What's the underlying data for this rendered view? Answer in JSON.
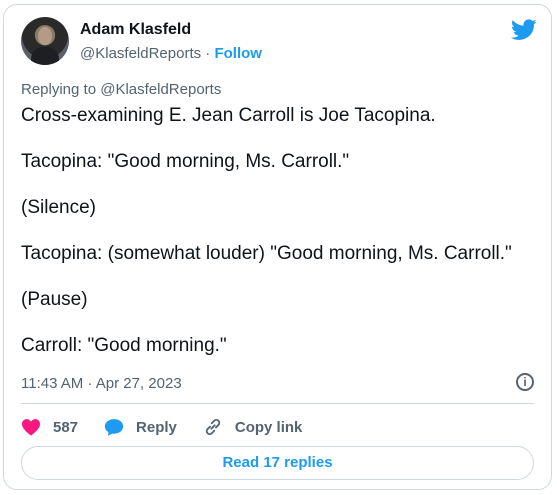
{
  "author": {
    "name": "Adam Klasfeld",
    "handle": "@KlasfeldReports",
    "separator": " · ",
    "follow_label": "Follow"
  },
  "replying_to": "Replying to @KlasfeldReports",
  "tweet_lines": [
    "Cross-examining E. Jean Carroll is Joe Tacopina.",
    "Tacopina: \"Good morning, Ms. Carroll.\"",
    "(Silence)",
    "Tacopina: (somewhat louder) \"Good morning, Ms. Carroll.\"",
    "(Pause)",
    "Carroll: \"Good morning.\""
  ],
  "timestamp": "11:43 AM · Apr 27, 2023",
  "actions": {
    "like_count": "587",
    "reply_label": "Reply",
    "copy_label": "Copy link"
  },
  "read_replies_label": "Read 17 replies",
  "icons": {
    "brand": "twitter-bird-icon",
    "info": "info-icon",
    "like": "heart-icon",
    "reply": "speech-bubble-icon",
    "copy": "link-icon"
  },
  "colors": {
    "accent": "#1d9bf0",
    "like": "#f91880",
    "text": "#0f1419",
    "muted": "#536471",
    "border": "#cfd9de"
  }
}
